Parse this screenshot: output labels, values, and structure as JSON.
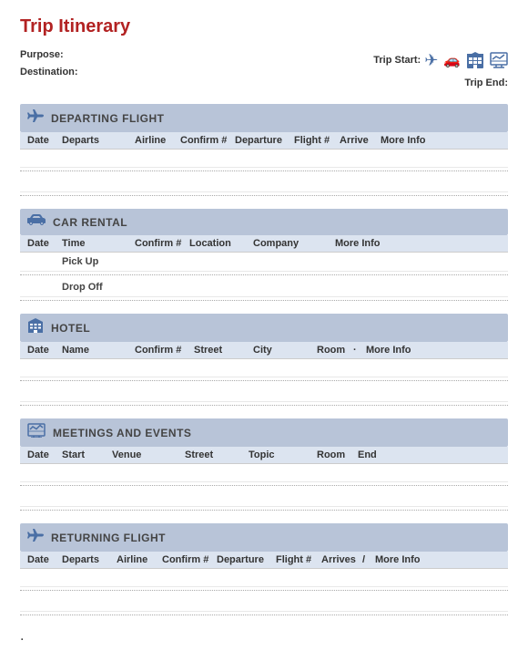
{
  "title": "Trip Itinerary",
  "meta": {
    "purpose_label": "Purpose:",
    "destination_label": "Destination:",
    "trip_start_label": "Trip Start:",
    "trip_end_label": "Trip End:"
  },
  "icons": {
    "plane": "✈",
    "car": "🚗",
    "hotel": "🏨",
    "chart": "📊",
    "departing_plane": "✈",
    "car_rental": "🚗",
    "hotel_icon": "🏢",
    "meetings_icon": "📈",
    "returning_plane": "✈"
  },
  "sections": {
    "departing": {
      "title": "DEPARTING FLIGHT",
      "columns": {
        "date": "Date",
        "departs": "Departs",
        "airline": "Airline",
        "confirm": "Confirm #",
        "departure": "Departure",
        "flight": "Flight #",
        "arrive": "Arrive",
        "moreinfo": "More Info"
      }
    },
    "car_rental": {
      "title": "CAR RENTAL",
      "columns": {
        "date": "Date",
        "time": "Time",
        "confirm": "Confirm #",
        "location": "Location",
        "company": "Company",
        "moreinfo": "More Info"
      },
      "rows": {
        "pickup": "Pick Up",
        "dropoff": "Drop Off"
      }
    },
    "hotel": {
      "title": "HOTEL",
      "columns": {
        "date": "Date",
        "name": "Name",
        "confirm": "Confirm #",
        "street": "Street",
        "city": "City",
        "room": "Room",
        "more": "·",
        "moreinfo": "More Info"
      }
    },
    "meetings": {
      "title": "MEETINGS AND EVENTS",
      "columns": {
        "date": "Date",
        "start": "Start",
        "venue": "Venue",
        "street": "Street",
        "topic": "Topic",
        "room": "Room",
        "end": "End"
      }
    },
    "returning": {
      "title": "RETURNING FLIGHT",
      "columns": {
        "date": "Date",
        "departs": "Departs",
        "airline": "Airline",
        "confirm": "Confirm #",
        "departure": "Departure",
        "flight": "Flight #",
        "arrives": "Arrives",
        "extra": "/",
        "moreinfo": "More Info"
      }
    }
  }
}
